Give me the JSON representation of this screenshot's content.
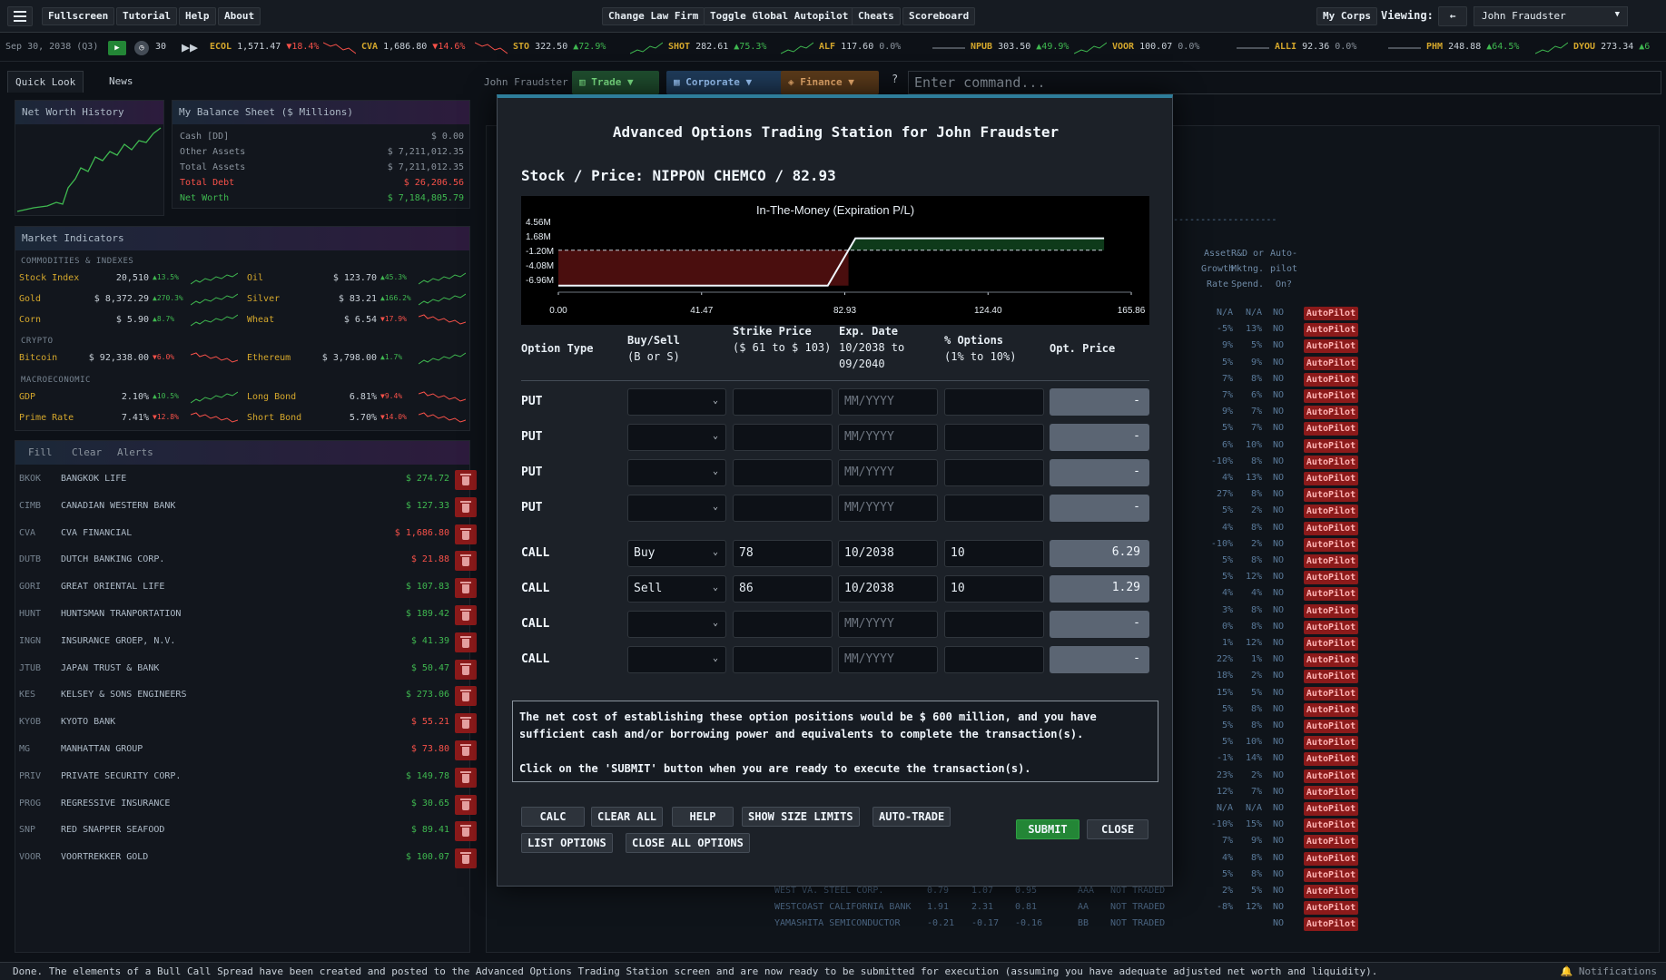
{
  "topbar": {
    "left_buttons": [
      "Fullscreen",
      "Tutorial",
      "Help",
      "About"
    ],
    "center_buttons": [
      "Change Law Firm",
      "Toggle Global Autopilot",
      "Cheats",
      "Scoreboard"
    ],
    "my_corps": "My Corps",
    "viewing_label": "Viewing:",
    "back": "←",
    "viewing_value": "John Fraudster"
  },
  "ticker": {
    "date": "Sep 30, 2038 (Q3)",
    "speed": "30",
    "items": [
      {
        "sym": "ECOL",
        "price": "1,571.47",
        "chg": "▼18.4%",
        "dir": "dn"
      },
      {
        "sym": "CVA",
        "price": "1,686.80",
        "chg": "▼14.6%",
        "dir": "dn"
      },
      {
        "sym": "STO",
        "price": "322.50",
        "chg": "▲72.9%",
        "dir": "up"
      },
      {
        "sym": "SHOT",
        "price": "282.61",
        "chg": "▲75.3%",
        "dir": "up"
      },
      {
        "sym": "ALF",
        "price": "117.60",
        "chg": "0.0%",
        "dir": "flat"
      },
      {
        "sym": "NPUB",
        "price": "303.50",
        "chg": "▲49.9%",
        "dir": "up"
      },
      {
        "sym": "VOOR",
        "price": "100.07",
        "chg": "0.0%",
        "dir": "flat"
      },
      {
        "sym": "ALLI",
        "price": "92.36",
        "chg": "0.0%",
        "dir": "flat"
      },
      {
        "sym": "PHM",
        "price": "248.88",
        "chg": "▲64.5%",
        "dir": "up"
      },
      {
        "sym": "DYOU",
        "price": "273.34",
        "chg": "▲6",
        "dir": "up"
      }
    ]
  },
  "left": {
    "tabs": [
      "Quick Look",
      "News"
    ],
    "net_worth_title": "Net Worth History",
    "balance_title": "My Balance Sheet ($ Millions)",
    "balance_rows": [
      {
        "label": "Cash [DD]",
        "value": "$ 0.00",
        "color": "#8b949e"
      },
      {
        "label": "Other Assets",
        "value": "$ 7,211,012.35",
        "color": "#8b949e"
      },
      {
        "label": "Total Assets",
        "value": "$ 7,211,012.35",
        "color": "#8b949e"
      },
      {
        "label": "Total Debt",
        "value": "$ 26,206.56",
        "color": "#f85149"
      },
      {
        "label": "Net Worth",
        "value": "$ 7,184,805.79",
        "color": "#3fb950"
      }
    ],
    "market_title": "Market Indicators",
    "sections": [
      "COMMODITIES & INDEXES",
      "CRYPTO",
      "MACROECONOMIC"
    ],
    "indicators": [
      {
        "name": "Stock Index",
        "price": "20,510",
        "chg": "▲13.5%",
        "dir": "up"
      },
      {
        "name": "Oil",
        "price": "$ 123.70",
        "chg": "▲45.3%",
        "dir": "up"
      },
      {
        "name": "Gold",
        "price": "$ 8,372.29",
        "chg": "▲270.3%",
        "dir": "up"
      },
      {
        "name": "Silver",
        "price": "$ 83.21",
        "chg": "▲166.2%",
        "dir": "up"
      },
      {
        "name": "Corn",
        "price": "$ 5.90",
        "chg": "▲8.7%",
        "dir": "up"
      },
      {
        "name": "Wheat",
        "price": "$ 6.54",
        "chg": "▼17.9%",
        "dir": "dn"
      },
      {
        "name": "Bitcoin",
        "price": "$ 92,338.00",
        "chg": "▼6.0%",
        "dir": "dn"
      },
      {
        "name": "Ethereum",
        "price": "$ 3,798.00",
        "chg": "▲1.7%",
        "dir": "up"
      },
      {
        "name": "GDP",
        "price": "2.10%",
        "chg": "▲10.5%",
        "dir": "up"
      },
      {
        "name": "Long Bond",
        "price": "6.81%",
        "chg": "▼9.4%",
        "dir": "dn"
      },
      {
        "name": "Prime Rate",
        "price": "7.41%",
        "chg": "▼12.8%",
        "dir": "dn"
      },
      {
        "name": "Short Bond",
        "price": "5.70%",
        "chg": "▼14.0%",
        "dir": "dn"
      }
    ],
    "watch_tabs": [
      "Fill",
      "Clear",
      "Alerts"
    ],
    "watchlist": [
      {
        "sym": "BKOK",
        "name": "BANGKOK LIFE",
        "price": "$ 274.72",
        "dir": "up"
      },
      {
        "sym": "CIMB",
        "name": "CANADIAN WESTERN BANK",
        "price": "$ 127.33",
        "dir": "up"
      },
      {
        "sym": "CVA",
        "name": "CVA FINANCIAL",
        "price": "$ 1,686.80",
        "dir": "dn"
      },
      {
        "sym": "DUTB",
        "name": "DUTCH BANKING CORP.",
        "price": "$ 21.88",
        "dir": "dn"
      },
      {
        "sym": "GORI",
        "name": "GREAT ORIENTAL LIFE",
        "price": "$ 107.83",
        "dir": "up"
      },
      {
        "sym": "HUNT",
        "name": "HUNTSMAN TRANPORTATION",
        "price": "$ 189.42",
        "dir": "up"
      },
      {
        "sym": "INGN",
        "name": "INSURANCE GROEP, N.V.",
        "price": "$ 41.39",
        "dir": "up"
      },
      {
        "sym": "JTUB",
        "name": "JAPAN TRUST & BANK",
        "price": "$ 50.47",
        "dir": "up"
      },
      {
        "sym": "KES",
        "name": "KELSEY & SONS ENGINEERS",
        "price": "$ 273.06",
        "dir": "up"
      },
      {
        "sym": "KYOB",
        "name": "KYOTO BANK",
        "price": "$ 55.21",
        "dir": "dn"
      },
      {
        "sym": "MG",
        "name": "MANHATTAN GROUP",
        "price": "$ 73.80",
        "dir": "dn"
      },
      {
        "sym": "PRIV",
        "name": "PRIVATE SECURITY CORP.",
        "price": "$ 149.78",
        "dir": "up"
      },
      {
        "sym": "PROG",
        "name": "REGRESSIVE INSURANCE",
        "price": "$ 30.65",
        "dir": "up"
      },
      {
        "sym": "SNP",
        "name": "RED SNAPPER SEAFOOD",
        "price": "$ 89.41",
        "dir": "up"
      },
      {
        "sym": "VOOR",
        "name": "VOORTREKKER GOLD",
        "price": "$ 100.07",
        "dir": "up"
      }
    ]
  },
  "cmdbar": {
    "user": "John Fraudster",
    "trade": "Trade ▼",
    "corporate": "Corporate ▼",
    "finance": "Finance ▼",
    "q": "?",
    "placeholder": "Enter command..."
  },
  "background": {
    "dashes": "-------------------",
    "headers": [
      "Asset Growth Rate",
      "R&D or Mktng. Spend.",
      "Auto- pilot On?"
    ],
    "growth": [
      "N/A",
      "-5%",
      "9%",
      "5%",
      "7%",
      "7%",
      "9%",
      "5%",
      "6%",
      "-10%",
      "4%",
      "27%",
      "5%",
      "4%",
      "-10%",
      "5%",
      "5%",
      "4%",
      "3%",
      "0%",
      "1%",
      "22%",
      "18%",
      "15%",
      "5%",
      "5%",
      "5%",
      "-1%",
      "23%",
      "12%",
      "N/A",
      "-10%",
      "7%",
      "4%",
      "5%",
      "2%",
      "-8%"
    ],
    "spend": [
      "N/A",
      "13%",
      "5%",
      "9%",
      "8%",
      "6%",
      "7%",
      "7%",
      "10%",
      "8%",
      "13%",
      "8%",
      "2%",
      "8%",
      "2%",
      "8%",
      "12%",
      "4%",
      "8%",
      "8%",
      "12%",
      "1%",
      "2%",
      "5%",
      "8%",
      "8%",
      "10%",
      "14%",
      "2%",
      "7%",
      "N/A",
      "15%",
      "9%",
      "8%",
      "8%",
      "5%",
      "12%"
    ],
    "autopilot": "AutoPilot",
    "no": "NO",
    "rows_bottom": [
      {
        "name": "WEST VA. STEEL CORP.",
        "a": "0.79",
        "b": "1.07",
        "c": "0.95",
        "r": "AAA",
        "t": "NOT TRADED"
      },
      {
        "name": "WESTCOAST CALIFORNIA BANK",
        "a": "1.91",
        "b": "2.31",
        "c": "0.81",
        "r": "AA",
        "t": "NOT TRADED"
      },
      {
        "name": "YAMASHITA SEMICONDUCTOR",
        "a": "-0.21",
        "b": "-0.17",
        "c": "-0.16",
        "r": "BB",
        "t": "NOT TRADED"
      }
    ]
  },
  "modal": {
    "title": "Advanced Options Trading Station for John Fraudster",
    "stock_line": "Stock / Price: NIPPON CHEMCO / 82.93",
    "headers": {
      "type": "Option Type",
      "buysell": "Buy/Sell",
      "buysell_sub": "(B or S)",
      "strike": "Strike Price",
      "strike_sub": "($ 61 to $ 103)",
      "exp": "Exp. Date",
      "exp_sub": "10/2038 to 09/2040",
      "pct": "% Options",
      "pct_sub": "(1% to 10%)",
      "price": "Opt. Price"
    },
    "exp_placeholder": "MM/YYYY",
    "rows": [
      {
        "type": "PUT",
        "bs": "",
        "strike": "",
        "exp": "",
        "pct": "",
        "price": "-"
      },
      {
        "type": "PUT",
        "bs": "",
        "strike": "",
        "exp": "",
        "pct": "",
        "price": "-"
      },
      {
        "type": "PUT",
        "bs": "",
        "strike": "",
        "exp": "",
        "pct": "",
        "price": "-"
      },
      {
        "type": "PUT",
        "bs": "",
        "strike": "",
        "exp": "",
        "pct": "",
        "price": "-"
      },
      {
        "type": "CALL",
        "bs": "Buy",
        "strike": "78",
        "exp": "10/2038",
        "pct": "10",
        "price": "6.29"
      },
      {
        "type": "CALL",
        "bs": "Sell",
        "strike": "86",
        "exp": "10/2038",
        "pct": "10",
        "price": "1.29"
      },
      {
        "type": "CALL",
        "bs": "",
        "strike": "",
        "exp": "",
        "pct": "",
        "price": "-"
      },
      {
        "type": "CALL",
        "bs": "",
        "strike": "",
        "exp": "",
        "pct": "",
        "price": "-"
      }
    ],
    "message_1": "The net cost of establishing these option positions would be $ 600 million, and you have sufficient cash and/or borrowing power and equivalents to complete the transaction(s).",
    "message_2": "Click on the 'SUBMIT' button when you are ready to execute the transaction(s).",
    "buttons": {
      "calc": "CALC",
      "clear_all": "CLEAR ALL",
      "help": "HELP",
      "show_size_limits": "SHOW SIZE LIMITS",
      "auto_trade": "AUTO-TRADE",
      "list_options": "LIST OPTIONS",
      "close_all_options": "CLOSE ALL OPTIONS",
      "submit": "SUBMIT",
      "close": "CLOSE"
    }
  },
  "chart_data": {
    "type": "line",
    "title": "In-The-Money (Expiration P/L)",
    "x_ticks": [
      "0.00",
      "41.47",
      "82.93",
      "124.40",
      "165.86"
    ],
    "y_ticks": [
      "4.56M",
      "1.68M",
      "-1.20M",
      "-4.08M",
      "-6.96M"
    ],
    "xlim": [
      0,
      165.86
    ],
    "ylim": [
      -6.96,
      4.56
    ],
    "x": [
      0,
      78,
      86,
      158
    ],
    "y": [
      -6.0,
      -6.0,
      2.0,
      2.0
    ],
    "breakeven_y": 0
  },
  "status": {
    "text": "Done. The elements of a Bull Call Spread have been created and posted to the Advanced Options Trading Station screen and are now ready to be submitted for execution (assuming you have adequate adjusted net worth and liquidity).",
    "notifications": "🔔 Notifications"
  }
}
